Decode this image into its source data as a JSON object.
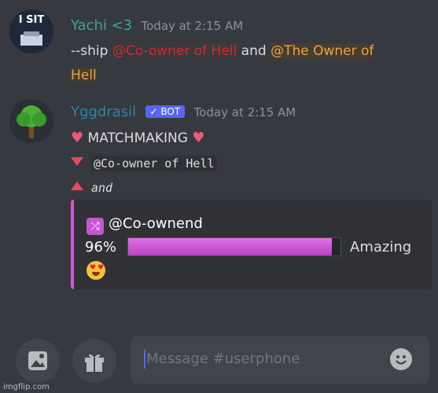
{
  "messages": [
    {
      "username": "Yachi <3",
      "timestamp": "Today at 2:15 AM",
      "avatar_text": "I SIT",
      "content": {
        "prefix": "--ship ",
        "mention1": "@Co-owner of Hell",
        "joiner": " and ",
        "mention2_part1": "@The Owner of",
        "mention2_part2": "Hell"
      }
    },
    {
      "username": "Yggdrasil",
      "badge": "✓ BOT",
      "timestamp": "Today at 2:15 AM",
      "heading": "MATCHMAKING",
      "line_down": "@Co-owner of Hell",
      "line_up": "and",
      "embed": {
        "title": "@Co-ownend",
        "percent": "96%",
        "fill_fraction": 0.96,
        "rating": "Amazing",
        "accent_color": "#d355d9"
      }
    }
  ],
  "composer": {
    "placeholder": "Message #userphone"
  },
  "watermark": "imgflip.com"
}
